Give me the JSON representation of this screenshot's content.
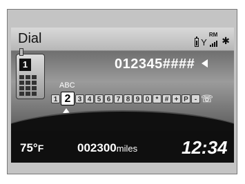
{
  "header": {
    "title": "Dial",
    "rm_label": "RM"
  },
  "dialer": {
    "number": "012345####",
    "selected_key_letters": "ABC",
    "keys": [
      "1",
      "2",
      "3",
      "4",
      "5",
      "6",
      "7",
      "8",
      "9",
      "0",
      "*",
      "#",
      "+",
      "P",
      "-"
    ],
    "selected_key": "2",
    "phone_display_digit": "1"
  },
  "footer": {
    "temperature_value": "75°",
    "temperature_unit": "F",
    "odometer_value": "002300",
    "odometer_unit": "miles",
    "clock": "12:34"
  },
  "icons": {
    "battery": "battery-icon",
    "antenna": "antenna-icon",
    "signal": "signal-bars-icon",
    "bluetooth": "bluetooth-icon",
    "backspace": "backspace-icon",
    "call": "call-icon",
    "phone": "phone-icon",
    "cursor": "cursor-icon"
  }
}
